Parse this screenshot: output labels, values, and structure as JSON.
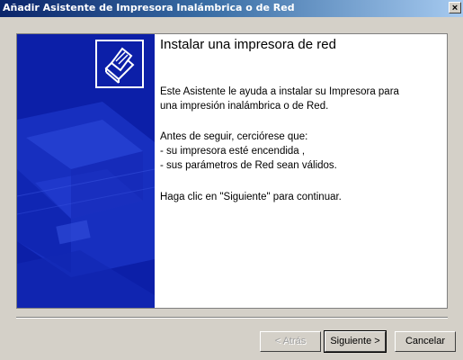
{
  "window": {
    "title": "Añadir Asistente de Impresora Inalámbrica o de Red",
    "close_glyph": "×"
  },
  "page": {
    "heading": "Instalar una impresora de red",
    "intro_line1": "Este Asistente le ayuda a instalar su Impresora para",
    "intro_line2": "una impresión inalámbrica o de Red.",
    "check_heading": "Antes de seguir, cerciórese que:",
    "check_item1": "- su impresora esté encendida ,",
    "check_item2": "- sus parámetros de Red sean válidos.",
    "continue_note": "Haga clic en \"Siguiente\" para continuar."
  },
  "buttons": {
    "back": "< Atrás",
    "next": "Siguiente >",
    "cancel": "Cancelar"
  },
  "icons": {
    "wizard_art": "printer-watermark",
    "header_icon": "printer-icon"
  },
  "colors": {
    "title_gradient_start": "#0a246a",
    "art_background": "#0c1fa8"
  }
}
